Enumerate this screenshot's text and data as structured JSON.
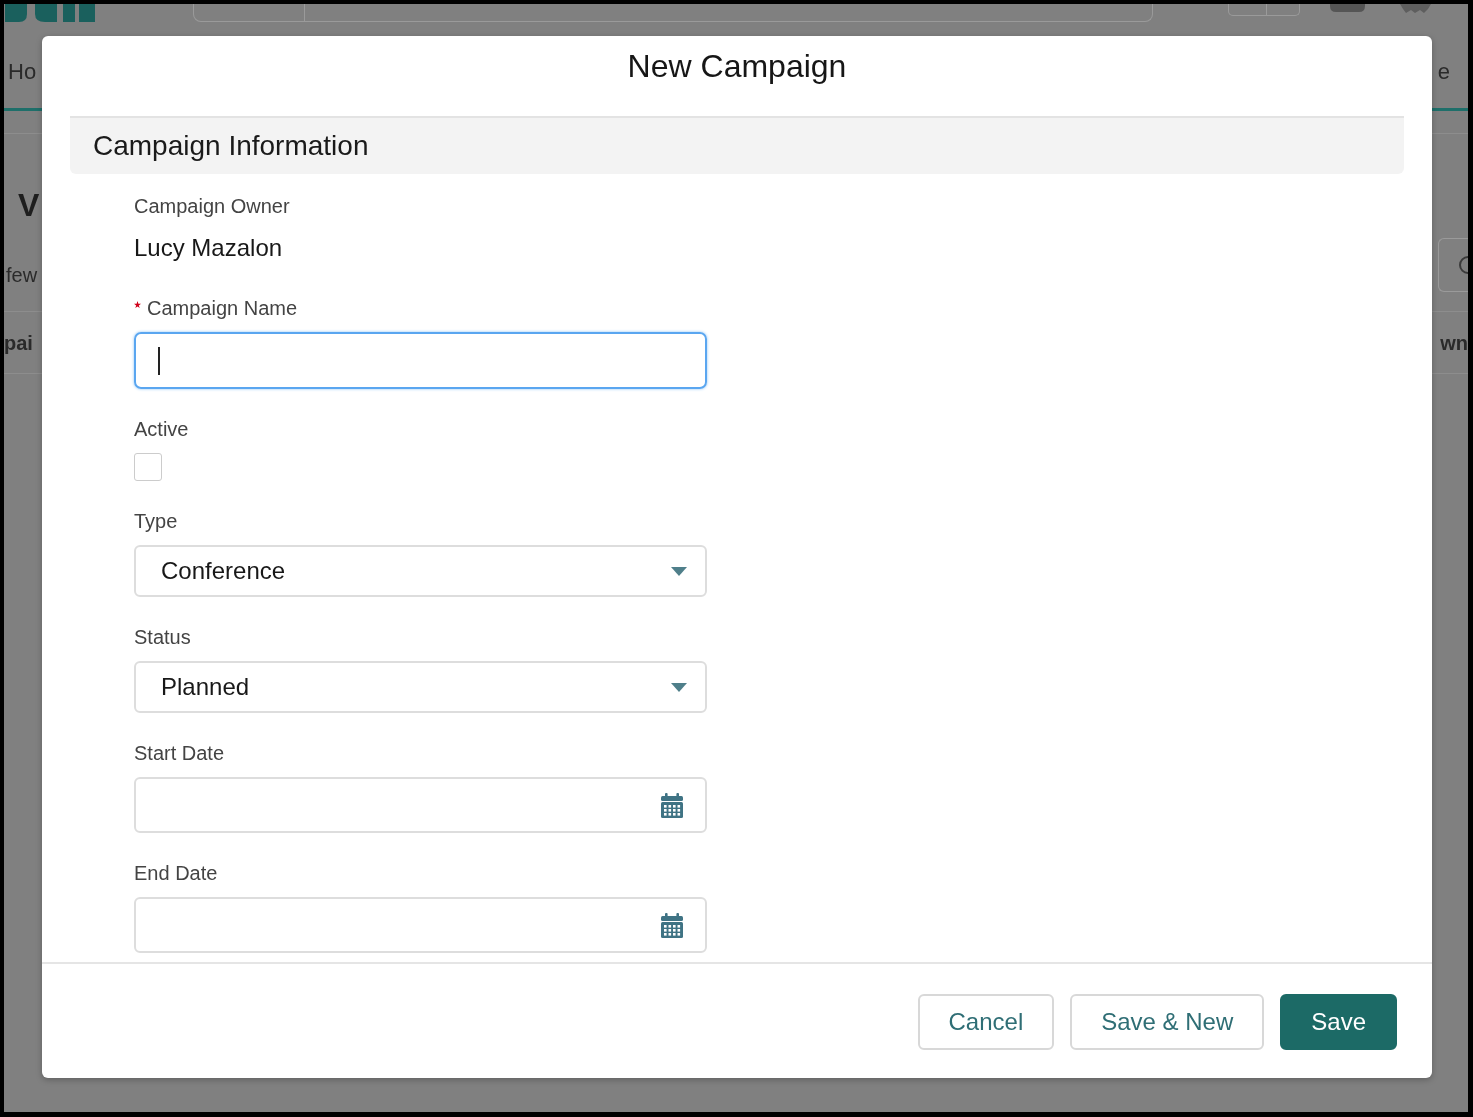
{
  "background_page": {
    "nav_tabs": [
      "Ho",
      "e"
    ],
    "page_title": "V",
    "page_subtitle": "few",
    "table_columns": [
      "pai",
      "wn"
    ]
  },
  "modal": {
    "title": "New Campaign",
    "section": "Campaign Information",
    "fields": [
      {
        "kind": "readonly",
        "label": "Campaign Owner",
        "value": "Lucy Mazalon",
        "required": false
      },
      {
        "kind": "text",
        "label": "Campaign Name",
        "required": true,
        "focused": true
      },
      {
        "kind": "checkbox",
        "label": "Active",
        "required": false,
        "checked": false
      },
      {
        "kind": "select",
        "label": "Type",
        "value": "Conference",
        "required": false,
        "focused": false
      },
      {
        "kind": "select",
        "label": "Status",
        "value": "Planned",
        "required": false,
        "focused": false
      },
      {
        "kind": "date",
        "label": "Start Date",
        "required": false,
        "focused": false
      },
      {
        "kind": "date",
        "label": "End Date",
        "required": false,
        "focused": false
      }
    ],
    "buttons": [
      {
        "label": "Cancel",
        "kind": "neutral"
      },
      {
        "label": "Save & New",
        "kind": "neutral"
      },
      {
        "label": "Save",
        "kind": "brand"
      }
    ]
  }
}
